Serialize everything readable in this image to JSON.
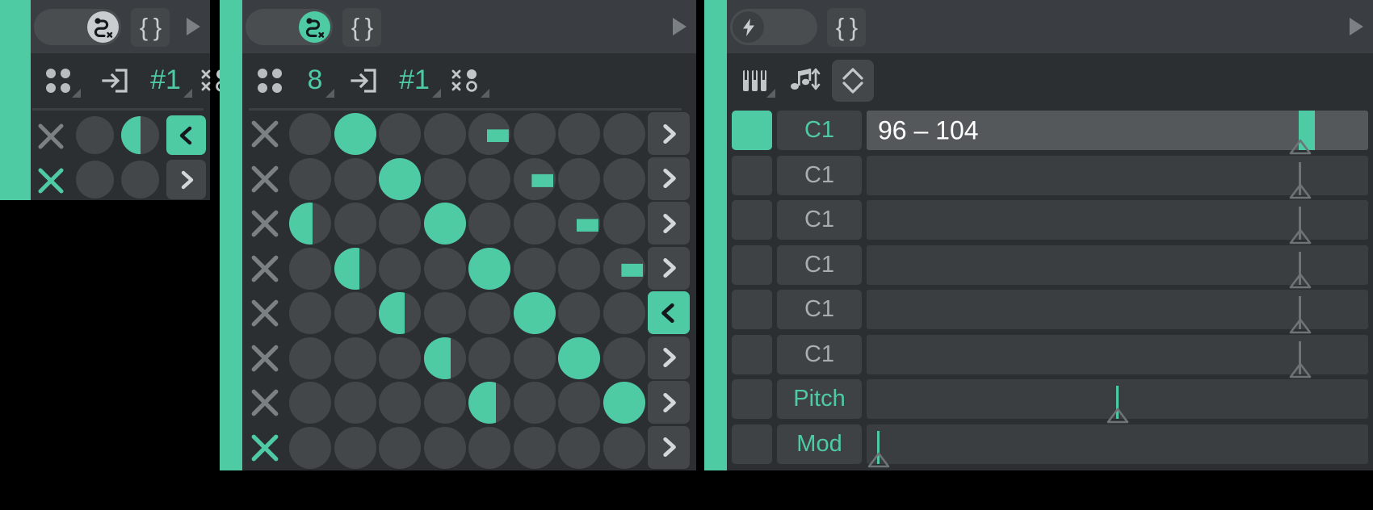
{
  "app": {
    "accent_color": "#4fcba4",
    "panel_bg": "#2c2f31",
    "titlebar_bg": "#3a3d41",
    "background": "#000000"
  },
  "panels": [
    {
      "id": "left-panel",
      "titlebar": {
        "toggle": {
          "state": "on",
          "icon": "route-x-icon"
        },
        "braces_label": "{ }",
        "play_icon": "play-triangle-icon"
      },
      "toolbar": [
        {
          "icon": "four-dots-icon",
          "label": "",
          "has_corner": true
        },
        {
          "icon": "enter-box-icon",
          "label": "",
          "has_corner": false
        },
        {
          "icon": "",
          "label": "#1",
          "accent": true,
          "has_corner": true
        },
        {
          "icon": "random-xo-icon",
          "label": "",
          "has_corner": true
        }
      ],
      "rows": [
        {
          "x_active": false,
          "steps": [
            0,
            0.5
          ],
          "button": {
            "glyph": "<",
            "active": true
          }
        },
        {
          "x_active": true,
          "steps": [
            0,
            0
          ],
          "button": {
            "glyph": ">",
            "active": false
          }
        }
      ]
    },
    {
      "id": "middle-panel",
      "titlebar": {
        "toggle": {
          "state": "green",
          "icon": "route-x-icon"
        },
        "braces_label": "{ }",
        "play_icon": "play-triangle-icon"
      },
      "toolbar": [
        {
          "icon": "four-dots-icon",
          "label": "",
          "has_corner": false
        },
        {
          "icon": "",
          "label": "8",
          "accent": true,
          "has_corner": true
        },
        {
          "icon": "enter-box-icon",
          "label": "",
          "has_corner": false
        },
        {
          "icon": "",
          "label": "#1",
          "accent": true,
          "has_corner": true
        },
        {
          "icon": "random-xo-icon",
          "label": "",
          "has_corner": true
        }
      ],
      "steps_per_row": 8,
      "rows": [
        {
          "x_active": false,
          "steps": [
            0,
            1,
            0,
            0,
            0.17,
            0,
            0,
            0
          ],
          "button": {
            "glyph": ">",
            "active": false
          }
        },
        {
          "x_active": false,
          "steps": [
            0,
            0,
            1,
            0,
            0,
            0.17,
            0,
            0
          ],
          "button": {
            "glyph": ">",
            "active": false
          }
        },
        {
          "x_active": false,
          "steps": [
            0.56,
            0,
            0,
            1,
            0,
            0,
            0.17,
            0
          ],
          "button": {
            "glyph": ">",
            "active": false
          }
        },
        {
          "x_active": false,
          "steps": [
            0,
            0.6,
            0,
            0,
            1,
            0,
            0,
            0.17
          ],
          "button": {
            "glyph": ">",
            "active": false
          }
        },
        {
          "x_active": false,
          "steps": [
            0,
            0,
            0.62,
            0,
            0,
            1,
            0,
            0
          ],
          "button": {
            "glyph": "<",
            "active": true
          }
        },
        {
          "x_active": false,
          "steps": [
            0,
            0,
            0,
            0.64,
            0,
            0,
            1,
            0
          ],
          "button": {
            "glyph": ">",
            "active": false
          }
        },
        {
          "x_active": false,
          "steps": [
            0,
            0,
            0,
            0,
            0.66,
            0,
            0,
            1
          ],
          "button": {
            "glyph": ">",
            "active": false
          }
        },
        {
          "x_active": true,
          "steps": [
            0,
            0,
            0,
            0,
            0,
            0,
            0,
            0
          ],
          "button": {
            "glyph": ">",
            "active": false
          }
        }
      ]
    },
    {
      "id": "right-panel",
      "titlebar": {
        "toggle": {
          "state": "off",
          "icon": "lightning-bolt-icon"
        },
        "braces_label": "{ }",
        "play_icon": "play-triangle-icon"
      },
      "toolbar": [
        {
          "icon": "piano-keys-icon",
          "label": "",
          "has_corner": true
        },
        {
          "icon": "note-updown-icon",
          "label": "",
          "has_corner": false
        },
        {
          "icon": "chevron-updown-icon",
          "label": "",
          "boxed": true,
          "has_corner": false
        }
      ],
      "rows": [
        {
          "enabled": true,
          "label": "C1",
          "label_accent": true,
          "value": "96 – 104",
          "selected": true,
          "handle_pos": 0.862,
          "handle_accent": true,
          "filled": true
        },
        {
          "enabled": false,
          "label": "C1",
          "label_accent": false,
          "value": "",
          "selected": false,
          "handle_pos": 0.862,
          "handle_accent": false,
          "filled": false
        },
        {
          "enabled": false,
          "label": "C1",
          "label_accent": false,
          "value": "",
          "selected": false,
          "handle_pos": 0.862,
          "handle_accent": false,
          "filled": false
        },
        {
          "enabled": false,
          "label": "C1",
          "label_accent": false,
          "value": "",
          "selected": false,
          "handle_pos": 0.862,
          "handle_accent": false,
          "filled": false
        },
        {
          "enabled": false,
          "label": "C1",
          "label_accent": false,
          "value": "",
          "selected": false,
          "handle_pos": 0.862,
          "handle_accent": false,
          "filled": false
        },
        {
          "enabled": false,
          "label": "C1",
          "label_accent": false,
          "value": "",
          "selected": false,
          "handle_pos": 0.862,
          "handle_accent": false,
          "filled": false
        },
        {
          "enabled": false,
          "label": "Pitch",
          "label_accent": true,
          "value": "",
          "selected": false,
          "handle_pos": 0.497,
          "handle_accent": true,
          "filled": false
        },
        {
          "enabled": false,
          "label": "Mod",
          "label_accent": true,
          "value": "",
          "selected": false,
          "handle_pos": 0.021,
          "handle_accent": true,
          "filled": false
        }
      ]
    }
  ]
}
